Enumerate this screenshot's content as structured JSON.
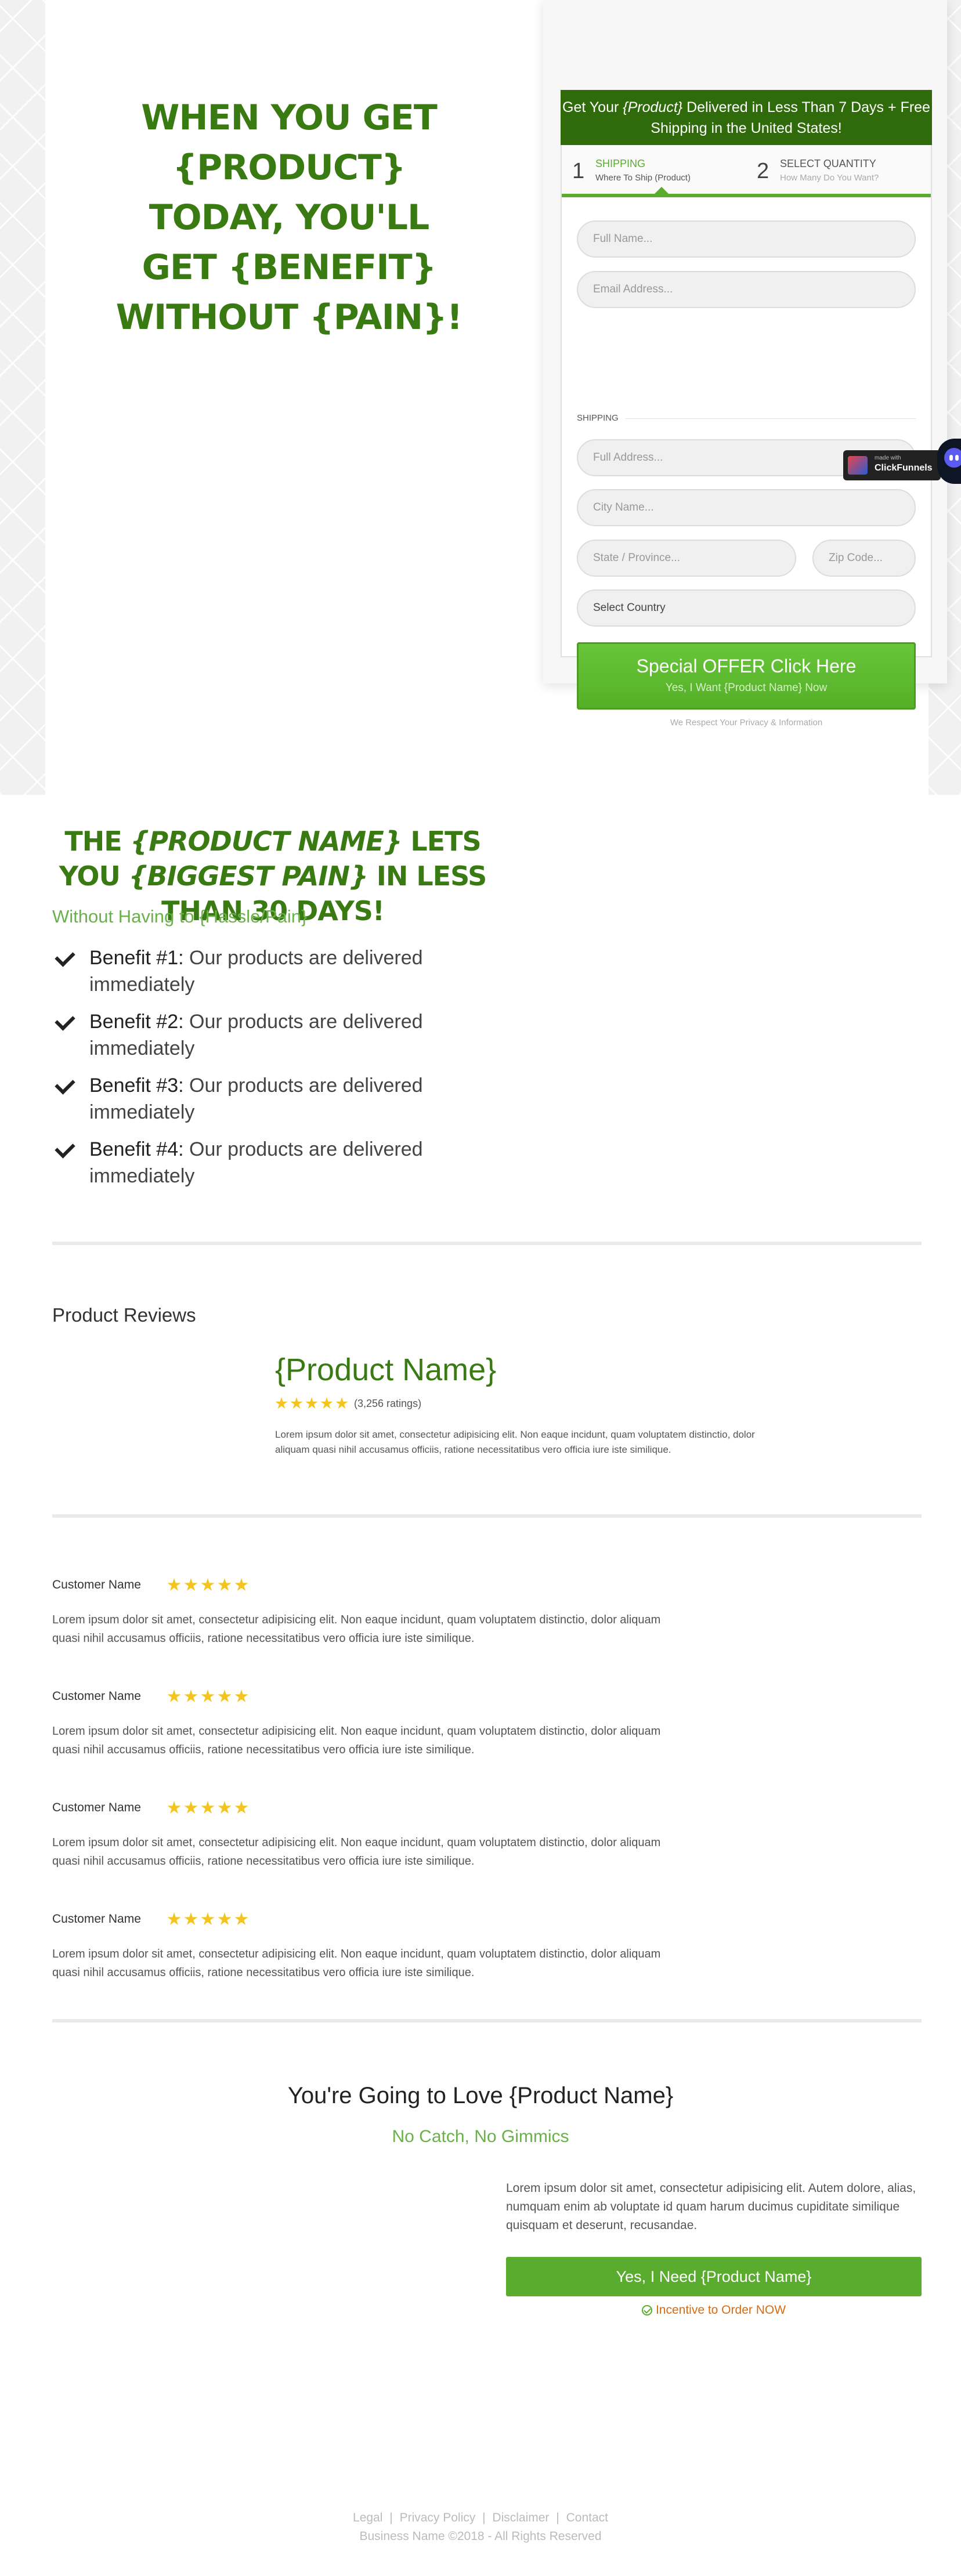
{
  "hero": {
    "headline": "WHEN YOU GET {PRODUCT} TODAY, YOU'LL GET {BENEFIT} WITHOUT {PAIN}!"
  },
  "order_form": {
    "banner_prefix": "Get Your ",
    "banner_product": "{Product}",
    "banner_suffix": " Delivered in Less Than 7 Days + Free Shipping in the United States!",
    "steps": [
      {
        "number": "1",
        "label": "SHIPPING",
        "sub": "Where To Ship (Product)"
      },
      {
        "number": "2",
        "label": "SELECT QUANTITY",
        "sub": "How Many Do You Want?"
      }
    ],
    "full_name_placeholder": "Full Name...",
    "email_placeholder": "Email Address...",
    "shipping_label": "SHIPPING",
    "address_placeholder": "Full Address...",
    "city_placeholder": "City Name...",
    "state_placeholder": "State / Province...",
    "zip_placeholder": "Zip Code...",
    "country_value": "Select Country",
    "cta_main": "Special OFFER Click Here",
    "cta_sub": "Yes, I Want {Product Name} Now",
    "privacy": "We Respect Your Privacy & Information"
  },
  "badge": {
    "made_with": "made with",
    "name": "ClickFunnels"
  },
  "benefits_section": {
    "title_part1": "THE ",
    "title_product": "{PRODUCT NAME}",
    "title_part2": " LETS YOU ",
    "title_pain": "{BIGGEST PAIN}",
    "title_part3": " IN ",
    "title_bold": "LESS THAN 30 DAYS!",
    "subtitle": "Without Having to {Hassle/Pain}",
    "items": [
      {
        "label": "Benefit #1:",
        "text": " Our products are delivered immediately"
      },
      {
        "label": "Benefit #2:",
        "text": " Our products are delivered immediately"
      },
      {
        "label": "Benefit #3:",
        "text": " Our products are delivered immediately"
      },
      {
        "label": "Benefit #4:",
        "text": " Our products are delivered immediately"
      }
    ]
  },
  "reviews": {
    "title": "Product Reviews",
    "product_name": "{Product Name}",
    "rating_stars": 5,
    "ratings_count": "(3,256 ratings)",
    "product_description": "Lorem ipsum dolor sit amet, consectetur adipisicing elit. Non eaque incidunt, quam voluptatem distinctio, dolor aliquam quasi nihil accusamus officiis, ratione necessitatibus vero officia iure iste similique.",
    "items": [
      {
        "name": "Customer Name",
        "stars": 5,
        "body": "Lorem ipsum dolor sit amet, consectetur adipisicing elit. Non eaque incidunt, quam voluptatem distinctio, dolor aliquam quasi nihil accusamus officiis, ratione necessitatibus vero officia iure iste similique."
      },
      {
        "name": "Customer Name",
        "stars": 5,
        "body": "Lorem ipsum dolor sit amet, consectetur adipisicing elit. Non eaque incidunt, quam voluptatem distinctio, dolor aliquam quasi nihil accusamus officiis, ratione necessitatibus vero officia iure iste similique."
      },
      {
        "name": "Customer Name",
        "stars": 5,
        "body": "Lorem ipsum dolor sit amet, consectetur adipisicing elit. Non eaque incidunt, quam voluptatem distinctio, dolor aliquam quasi nihil accusamus officiis, ratione necessitatibus vero officia iure iste similique."
      },
      {
        "name": "Customer Name",
        "stars": 5,
        "body": "Lorem ipsum dolor sit amet, consectetur adipisicing elit. Non eaque incidunt, quam voluptatem distinctio, dolor aliquam quasi nihil accusamus officiis, ratione necessitatibus vero officia iure iste similique."
      }
    ]
  },
  "closing": {
    "title": "You're Going to Love {Product Name}",
    "subtitle": "No Catch, No Gimmics",
    "description": "Lorem ipsum dolor sit amet, consectetur adipisicing elit. Autem dolore, alias, numquam enim ab voluptate id quam harum ducimus cupiditate similique quisquam et deserunt, recusandae.",
    "button": "Yes, I Need {Product Name}",
    "incentive": "Incentive to Order NOW"
  },
  "footer": {
    "links": [
      "Legal",
      "Privacy Policy",
      "Disclaimer",
      "Contact"
    ],
    "separator": "|",
    "copyright": "Business Name ©2018 - All Rights Reserved"
  },
  "colors": {
    "brand_green": "#3a7a13",
    "banner_green": "#2f6b0a",
    "accent_green": "#5aac2f",
    "star_yellow": "#f4c41d",
    "incentive_orange": "#d96b10"
  }
}
